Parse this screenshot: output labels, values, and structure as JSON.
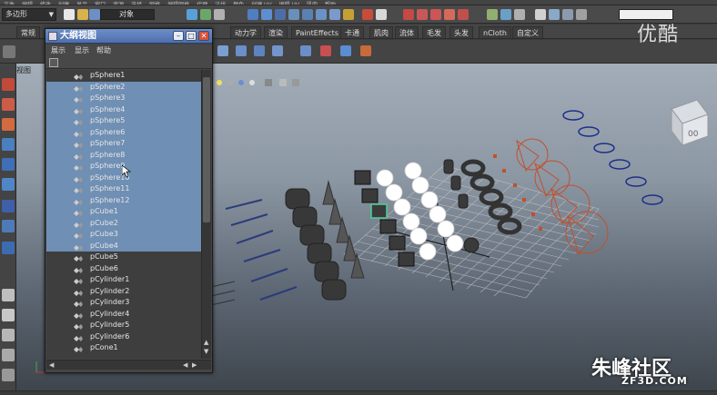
{
  "menubar": [
    "文件",
    "编辑",
    "修改",
    "创建",
    "显示",
    "窗口",
    "资源",
    "选择",
    "网格",
    "编辑网格",
    "代理",
    "法线",
    "颜色",
    "创建 UV",
    "编辑 UV",
    "肌肉",
    "帮助"
  ],
  "statusline": {
    "mode": "多边形",
    "object_field": "对象"
  },
  "shelf_tabs": [
    "常规",
    "动力学",
    "渲染",
    "PaintEffects",
    "卡通",
    "肌肉",
    "流体",
    "毛发",
    "头发",
    "nCloth",
    "自定义"
  ],
  "viewport": {
    "panel_menu": "视图"
  },
  "outliner": {
    "title": "大纲视图",
    "menu": [
      "展示",
      "显示",
      "帮助"
    ],
    "items": [
      {
        "label": "pSphere1",
        "selected": false
      },
      {
        "label": "pSphere2",
        "selected": true
      },
      {
        "label": "pSphere3",
        "selected": true
      },
      {
        "label": "pSphere4",
        "selected": true
      },
      {
        "label": "pSphere5",
        "selected": true
      },
      {
        "label": "pSphere6",
        "selected": true
      },
      {
        "label": "pSphere7",
        "selected": true
      },
      {
        "label": "pSphere8",
        "selected": true
      },
      {
        "label": "pSphere9",
        "selected": true
      },
      {
        "label": "pSphere10",
        "selected": true
      },
      {
        "label": "pSphere11",
        "selected": true
      },
      {
        "label": "pSphere12",
        "selected": true
      },
      {
        "label": "pCube1",
        "selected": true
      },
      {
        "label": "pCube2",
        "selected": true
      },
      {
        "label": "pCube3",
        "selected": true
      },
      {
        "label": "pCube4",
        "selected": true
      },
      {
        "label": "pCube5",
        "selected": false
      },
      {
        "label": "pCube6",
        "selected": false
      },
      {
        "label": "pCylinder1",
        "selected": false
      },
      {
        "label": "pCylinder2",
        "selected": false
      },
      {
        "label": "pCylinder3",
        "selected": false
      },
      {
        "label": "pCylinder4",
        "selected": false
      },
      {
        "label": "pCylinder5",
        "selected": false
      },
      {
        "label": "pCylinder6",
        "selected": false
      },
      {
        "label": "pCone1",
        "selected": false
      }
    ]
  },
  "watermarks": {
    "top_right": "优酷",
    "bottom_right": "朱峰社区",
    "bottom_right_url": "ZF3D.COM"
  },
  "viewcube_label": "00",
  "colors": {
    "selection": "#6f8fb4",
    "title_bar": "#5a7bb9",
    "locator_red": "#c0502c",
    "circle_blue": "#1d2f8a"
  }
}
